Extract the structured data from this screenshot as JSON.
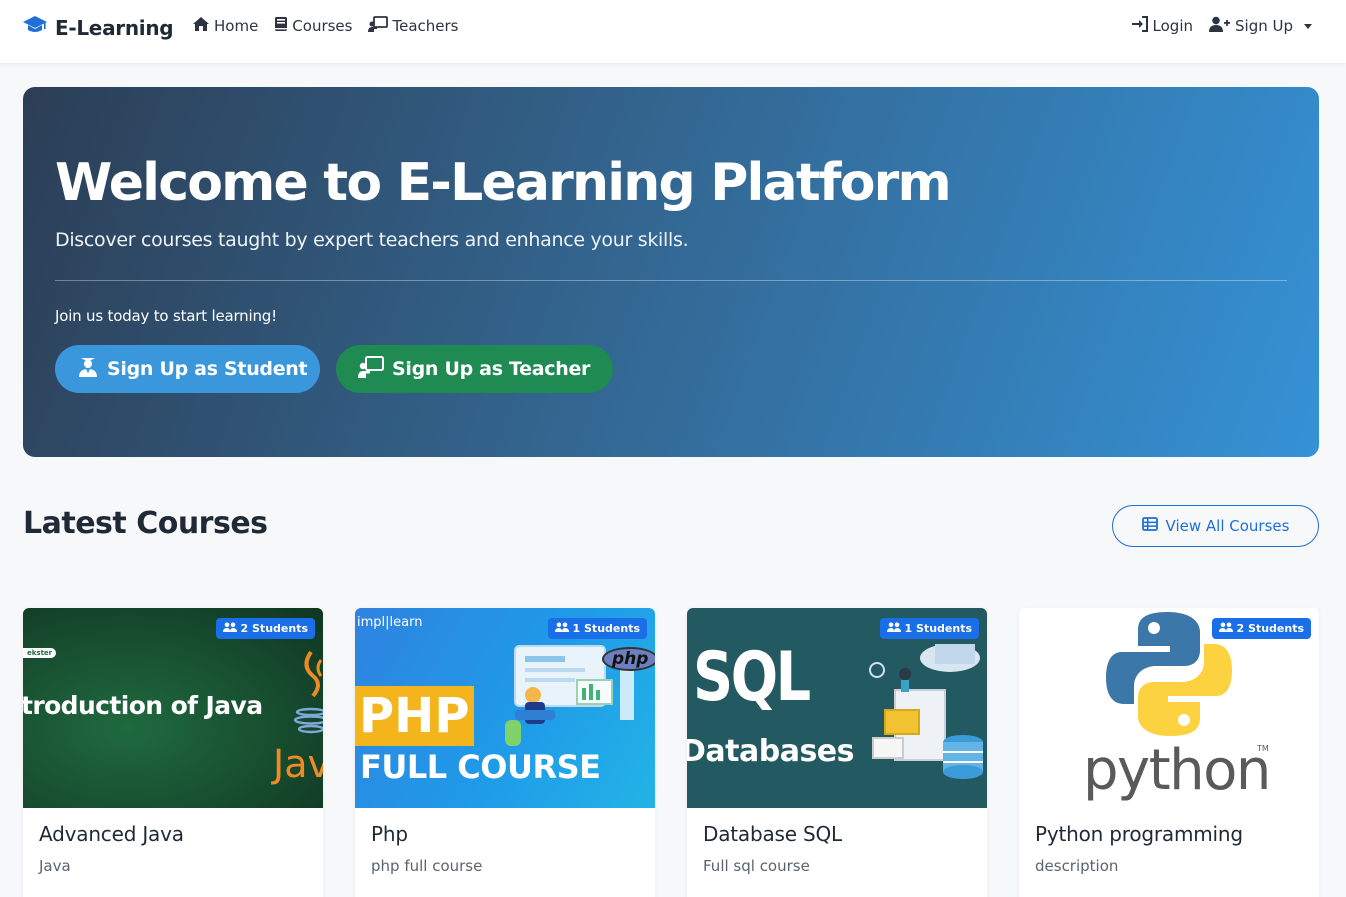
{
  "nav": {
    "brand": "E-Learning",
    "links": [
      "Home",
      "Courses",
      "Teachers"
    ],
    "login": "Login",
    "signup": "Sign Up"
  },
  "hero": {
    "title": "Welcome to E-Learning Platform",
    "subtitle": "Discover courses taught by expert teachers and enhance your skills.",
    "join": "Join us today to start learning!",
    "student_btn": "Sign Up as Student",
    "teacher_btn": "Sign Up as Teacher"
  },
  "section": {
    "title": "Latest Courses",
    "view_all": "View All Courses"
  },
  "courses": [
    {
      "title": "Advanced Java",
      "desc": "Java",
      "students": "2 Students",
      "img_text": [
        "troduction of Java",
        "Jav",
        "ekster"
      ]
    },
    {
      "title": "Php",
      "desc": "php full course",
      "students": "1 Students",
      "img_text": [
        "PHP",
        "FULL COURSE",
        "impl|learn",
        "php"
      ]
    },
    {
      "title": "Database SQL",
      "desc": "Full sql course",
      "students": "1 Students",
      "img_text": [
        "SQL",
        "Databases"
      ]
    },
    {
      "title": "Python programming",
      "desc": "description",
      "students": "2 Students",
      "img_text": [
        "python",
        "TM"
      ]
    }
  ],
  "colors": {
    "primary": "#1f6fd6",
    "student_btn": "#3a97dc",
    "teacher_btn": "#1f8a52",
    "badge": "#1a6ee8"
  }
}
